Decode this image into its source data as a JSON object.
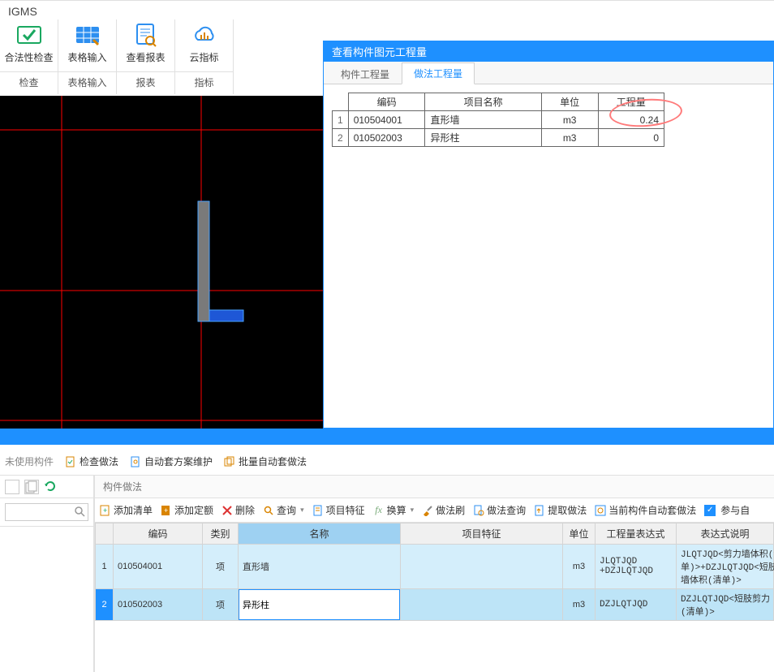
{
  "app": {
    "title": "IGMS"
  },
  "ribbon": {
    "groups": [
      {
        "label": "检查",
        "items": [
          {
            "name": "check-validity",
            "label": "合法性检查",
            "icon": "check"
          }
        ]
      },
      {
        "label": "表格输入",
        "items": [
          {
            "name": "table-input",
            "label": "表格输入",
            "icon": "grid"
          }
        ]
      },
      {
        "label": "报表",
        "items": [
          {
            "name": "view-report",
            "label": "查看报表",
            "icon": "report"
          }
        ]
      },
      {
        "label": "指标",
        "items": [
          {
            "name": "cloud-index",
            "label": "云指标",
            "icon": "cloud"
          }
        ]
      }
    ]
  },
  "popup": {
    "title": "查看构件图元工程量",
    "tabs": [
      {
        "name": "tab-gjl",
        "label": "构件工程量",
        "active": false
      },
      {
        "name": "tab-zfl",
        "label": "做法工程量",
        "active": true
      }
    ],
    "columns": {
      "code": "编码",
      "name": "项目名称",
      "unit": "单位",
      "qty": "工程量"
    },
    "rows": [
      {
        "idx": "1",
        "code": "010504001",
        "name": "直形墙",
        "unit": "m3",
        "qty": "0.24"
      },
      {
        "idx": "2",
        "code": "010502003",
        "name": "异形柱",
        "unit": "m3",
        "qty": "0"
      }
    ]
  },
  "bar2": {
    "unused": "未使用构件",
    "check": "检查做法",
    "auto": "自动套方案维护",
    "batch": "批量自动套做法"
  },
  "rpanel": {
    "title": "构件做法",
    "tb": {
      "add_list": "添加清单",
      "add_norm": "添加定额",
      "delete": "删除",
      "query": "查询",
      "feature": "项目特征",
      "fx": "fx",
      "convert": "换算",
      "brush": "做法刷",
      "practice_query": "做法查询",
      "extract": "提取做法",
      "auto_current": "当前构件自动套做法",
      "participate": "参与自"
    },
    "headers": {
      "code": "编码",
      "cat": "类别",
      "name": "名称",
      "feat": "项目特征",
      "unit": "单位",
      "expr": "工程量表达式",
      "desc": "表达式说明"
    },
    "rows": [
      {
        "idx": "1",
        "code": "010504001",
        "cat": "项",
        "name": "直形墙",
        "feat": "",
        "unit": "m3",
        "expr": "JLQTJQD\n+DZJLQTJQD",
        "desc": "JLQTJQD<剪力墙体积(清\n单)>+DZJLQTJQD<短肢\n墙体积(清单)>"
      },
      {
        "idx": "2",
        "code": "010502003",
        "cat": "项",
        "name": "异形柱",
        "feat": "",
        "unit": "m3",
        "expr": "DZJLQTJQD",
        "desc": "DZJLQTJQD<短肢剪力\n(清单)>"
      }
    ]
  },
  "colors": {
    "accent": "#1e90ff"
  }
}
